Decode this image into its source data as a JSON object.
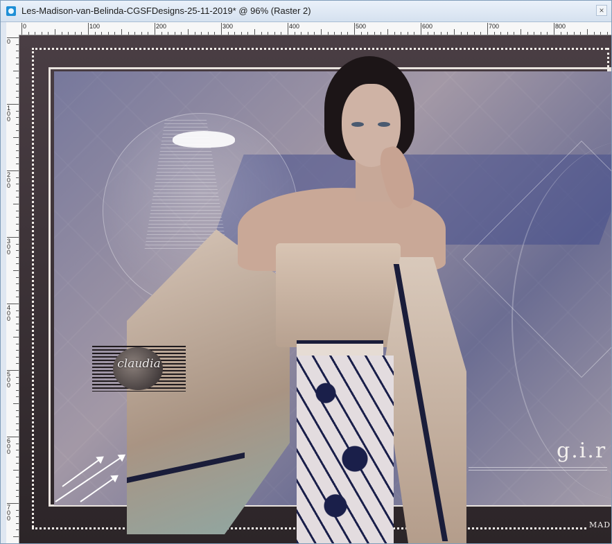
{
  "window": {
    "title": "Les-Madison-van-Belinda-CGSFDesigns-25-11-2019* @  96% (Raster 2)",
    "close_glyph": "×"
  },
  "rulers": {
    "top_labels": [
      "0",
      "100",
      "200",
      "300",
      "400",
      "500",
      "600",
      "700",
      "800"
    ],
    "left_labels": [
      "0",
      "100",
      "200",
      "300",
      "400",
      "500",
      "600",
      "700"
    ]
  },
  "artwork": {
    "watermark_text": "claudia",
    "corner_text": "g.i.r",
    "signature_text": "MAD"
  },
  "icons": {
    "app": "psp-image-icon",
    "close": "close-icon"
  },
  "colors": {
    "frame_dark": "#2c2528",
    "dots": "#f3eee9",
    "accent_navy": "#1a1d3a",
    "lavender": "#8d8aa3"
  }
}
